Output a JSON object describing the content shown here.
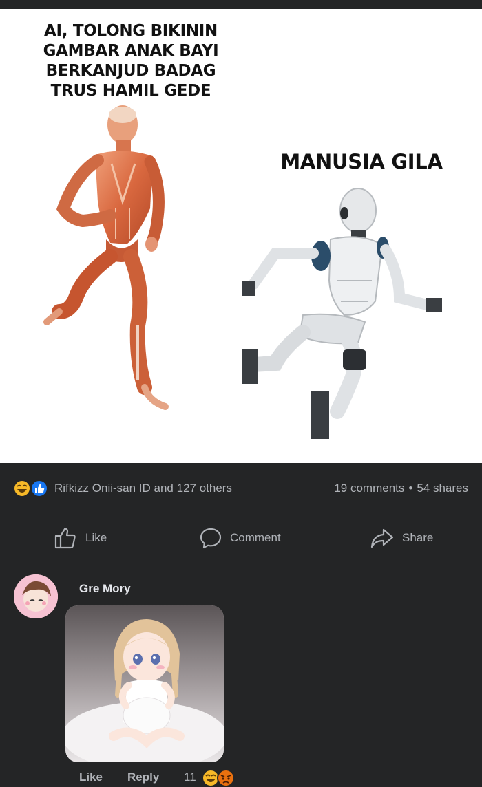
{
  "meme": {
    "caption_left_lines": [
      "AI, TOLONG BIKININ",
      "GAMBAR ANAK BAYI",
      "BERKANJUD BADAG",
      "TRUS HAMIL GEDE"
    ],
    "caption_right": "MANUSIA GILA"
  },
  "post_stats": {
    "reactions": [
      "haha",
      "like"
    ],
    "reactors": "Rifkizz Onii-san ID and 127 others",
    "comments": "19 comments",
    "separator": "•",
    "shares": "54 shares"
  },
  "actions": {
    "like": "Like",
    "comment": "Comment",
    "share": "Share"
  },
  "comment": {
    "author": "Gre Mory",
    "like": "Like",
    "reply": "Reply",
    "reaction_count": "11",
    "reactions": [
      "haha",
      "angry"
    ]
  },
  "colors": {
    "background": "#242526",
    "text_secondary": "#b0b3b8",
    "like_blue": "#1877f2",
    "haha_yellow": "#f7b928"
  }
}
